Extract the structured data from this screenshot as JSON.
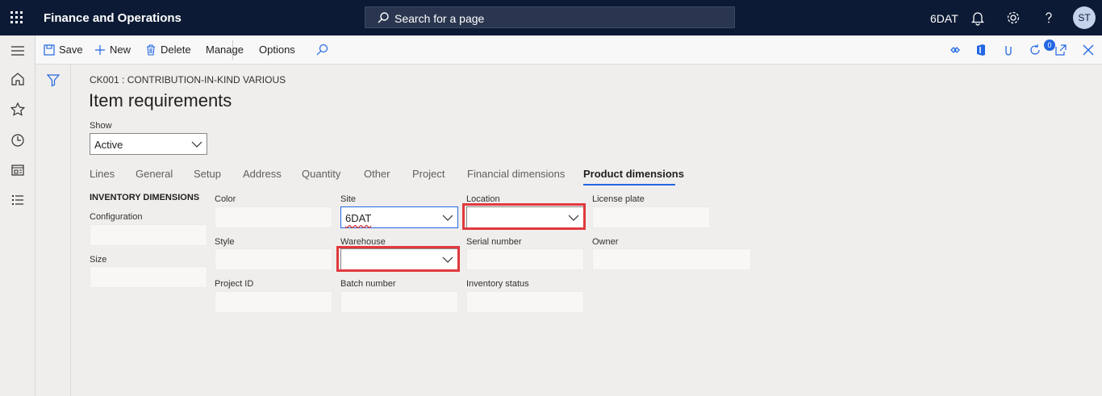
{
  "topbar": {
    "app_title": "Finance and Operations",
    "search_placeholder": "Search for a page",
    "company": "6DAT",
    "user_initials": "ST",
    "icons": [
      "waffle-icon",
      "search-icon",
      "bell-icon",
      "gear-icon",
      "help-icon"
    ]
  },
  "leftnav": {
    "icons": [
      "hamburger-icon",
      "home-icon",
      "star-icon",
      "clock-icon",
      "workspace-icon",
      "list-icon"
    ]
  },
  "actionpane": {
    "save": "Save",
    "new": "New",
    "delete": "Delete",
    "manage": "Manage",
    "options": "Options",
    "attachments_count": "0",
    "icons": [
      "diamond-icon",
      "office-icon",
      "attachment-icon",
      "refresh-icon",
      "popout-icon",
      "close-icon"
    ]
  },
  "page": {
    "caption": "CK001 : CONTRIBUTION-IN-KIND VARIOUS",
    "title": "Item requirements",
    "show_label": "Show",
    "show_value": "Active"
  },
  "tabs": [
    {
      "label": "Lines"
    },
    {
      "label": "General"
    },
    {
      "label": "Setup"
    },
    {
      "label": "Address"
    },
    {
      "label": "Quantity"
    },
    {
      "label": "Other"
    },
    {
      "label": "Project"
    },
    {
      "label": "Financial dimensions"
    },
    {
      "label": "Product dimensions",
      "active": true
    }
  ],
  "dimensions": {
    "section_title": "INVENTORY DIMENSIONS",
    "configuration": {
      "label": "Configuration",
      "value": ""
    },
    "size": {
      "label": "Size",
      "value": ""
    },
    "color": {
      "label": "Color",
      "value": ""
    },
    "style": {
      "label": "Style",
      "value": ""
    },
    "project_id": {
      "label": "Project ID",
      "value": ""
    },
    "site": {
      "label": "Site",
      "value": "6DAT"
    },
    "warehouse": {
      "label": "Warehouse",
      "value": ""
    },
    "batch_number": {
      "label": "Batch number",
      "value": ""
    },
    "location": {
      "label": "Location",
      "value": ""
    },
    "serial_number": {
      "label": "Serial number",
      "value": ""
    },
    "inventory_status": {
      "label": "Inventory status",
      "value": ""
    },
    "license_plate": {
      "label": "License plate",
      "value": ""
    },
    "owner": {
      "label": "Owner",
      "value": ""
    }
  },
  "colors": {
    "topbar": "#0c1a35",
    "accent": "#2266e3",
    "highlight": "#e0393e"
  }
}
